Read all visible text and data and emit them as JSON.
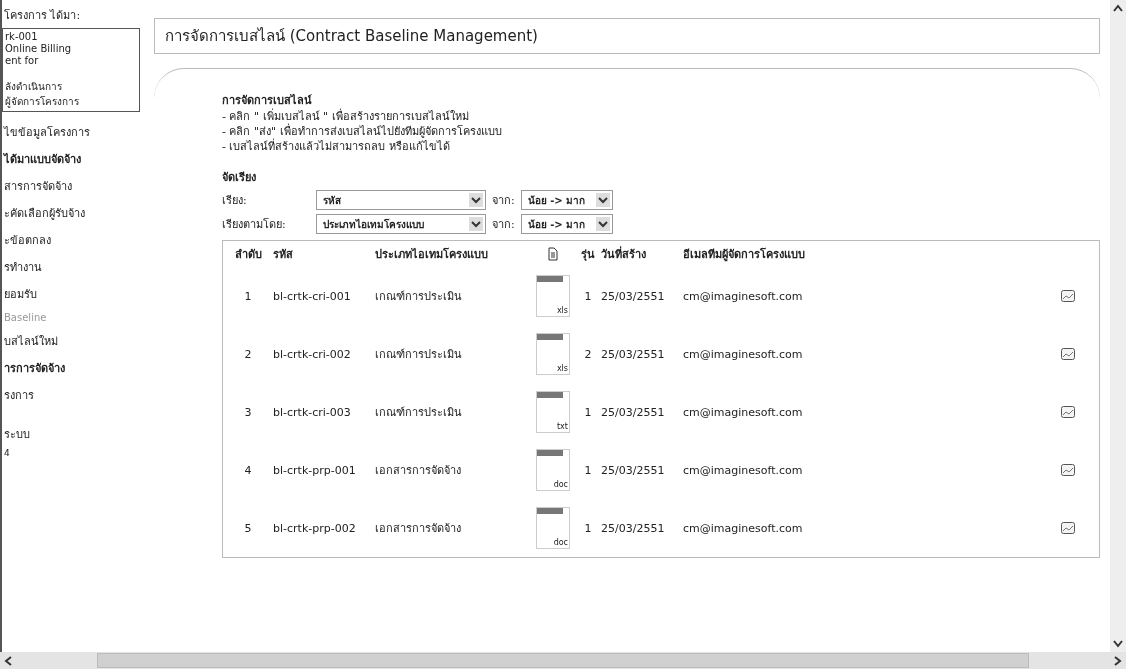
{
  "sidebar": {
    "project_label": "โครงการ ได้มา:",
    "project_box": [
      [
        "rk-001",
        "Online Billing",
        "ent for"
      ],
      [
        "ลังดำเนินการ",
        "ผู้จัดการโครงการ"
      ]
    ],
    "items": [
      {
        "label": "ไขข้อมูลโครงการ",
        "kind": "link"
      },
      {
        "label": "ได้มาแบบจัดจ้าง",
        "kind": "header"
      },
      {
        "label": "สารการจัดจ้าง",
        "kind": "link"
      },
      {
        "label": "ะคัดเลือกผู้รับจ้าง",
        "kind": "link"
      },
      {
        "label": "ะข้อตกลง",
        "kind": "link"
      },
      {
        "label": "รทำงาน",
        "kind": "link"
      },
      {
        "label": "ยอมรับ",
        "kind": "link"
      },
      {
        "label": "Baseline",
        "kind": "disabled"
      },
      {
        "label": "บสไลน์ใหม่",
        "kind": "link"
      },
      {
        "label": "ารการจัดจ้าง",
        "kind": "header"
      },
      {
        "label": "รงการ",
        "kind": "link"
      }
    ],
    "footer_items": [
      {
        "label": "ระบบ",
        "kind": "link"
      },
      {
        "label": "4",
        "kind": "small"
      }
    ]
  },
  "title": "การจัดการเบสไลน์ (Contract Baseline Management)",
  "instructions": {
    "heading": "การจัดการเบสไลน์",
    "lines": [
      "- คลิก \" เพิ่มเบสไลน์ \" เพื่อสร้างรายการเบสไลน์ใหม่",
      "- คลิก \"ส่ง\" เพื่อทำการส่งเบสไลน์ไปยังทีมผู้จัดการโครงแบบ",
      "- เบสไลน์ที่สร้างแล้วไม่สามารถลบ หรือแก้ไขได้"
    ]
  },
  "sort": {
    "heading": "จัดเรียง",
    "rows": [
      {
        "label": "เรียง:",
        "field": "รหัส",
        "order_label": "จาก:",
        "order": "น้อย -> มาก"
      },
      {
        "label": "เรียงตามโดย:",
        "field": "ประเภทไอเทมโครงแบบ",
        "order_label": "จาก:",
        "order": "น้อย -> มาก"
      }
    ]
  },
  "table": {
    "columns": [
      "ลำดับ",
      "รหัส",
      "ประเภทไอเทมโครงแบบ",
      "",
      "รุ่น",
      "วันที่สร้าง",
      "อีเมลทีมผู้จัดการโครงแบบ"
    ],
    "rows": [
      {
        "no": "1",
        "code": "bl-crtk-cri-001",
        "type": "เกณฑ์การประเมิน",
        "file": "xls",
        "version": "1",
        "date": "25/03/2551",
        "email": "cm@imaginesoft.com"
      },
      {
        "no": "2",
        "code": "bl-crtk-cri-002",
        "type": "เกณฑ์การประเมิน",
        "file": "xls",
        "version": "2",
        "date": "25/03/2551",
        "email": "cm@imaginesoft.com"
      },
      {
        "no": "3",
        "code": "bl-crtk-cri-003",
        "type": "เกณฑ์การประเมิน",
        "file": "txt",
        "version": "1",
        "date": "25/03/2551",
        "email": "cm@imaginesoft.com"
      },
      {
        "no": "4",
        "code": "bl-crtk-prp-001",
        "type": "เอกสารการจัดจ้าง",
        "file": "doc",
        "version": "1",
        "date": "25/03/2551",
        "email": "cm@imaginesoft.com"
      },
      {
        "no": "5",
        "code": "bl-crtk-prp-002",
        "type": "เอกสารการจัดจ้าง",
        "file": "doc",
        "version": "1",
        "date": "25/03/2551",
        "email": "cm@imaginesoft.com"
      }
    ]
  }
}
